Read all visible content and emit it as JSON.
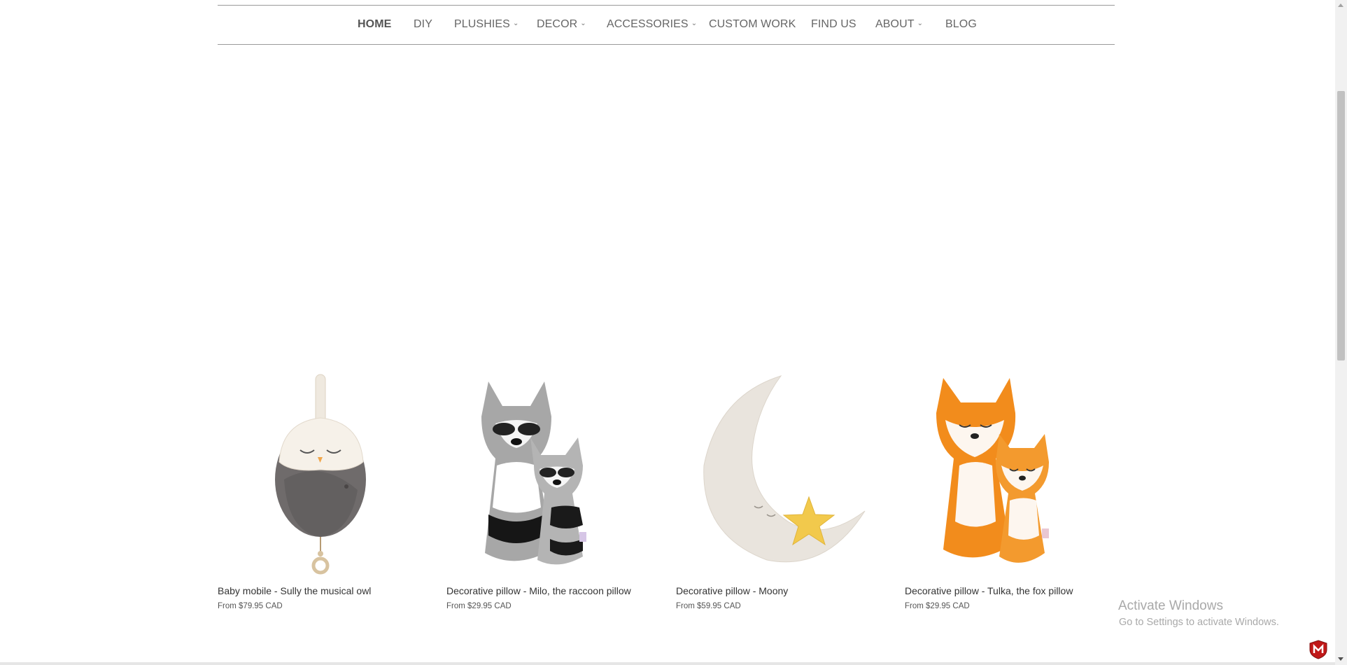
{
  "nav": {
    "items": [
      {
        "label": "HOME",
        "active": true,
        "dropdown": false
      },
      {
        "label": "DIY",
        "dropdown": false
      },
      {
        "label": "PLUSHIES",
        "dropdown": true
      },
      {
        "label": "DECOR",
        "dropdown": true
      },
      {
        "label": "ACCESSORIES",
        "dropdown": true
      },
      {
        "label": "CUSTOM WORK",
        "dropdown": false
      },
      {
        "label": "FIND US",
        "dropdown": false
      },
      {
        "label": "ABOUT",
        "dropdown": true
      },
      {
        "label": "BLOG",
        "dropdown": false
      }
    ],
    "chevron_glyph": "⌄"
  },
  "products": [
    {
      "title": "Baby mobile - Sully the musical owl",
      "price": "From $79.95 CAD",
      "image_icon": "owl-mobile-image"
    },
    {
      "title": "Decorative pillow - Milo, the raccoon pillow",
      "price": "From $29.95 CAD",
      "image_icon": "raccoon-pillow-image"
    },
    {
      "title": "Decorative pillow - Moony",
      "price": "From $59.95 CAD",
      "image_icon": "moon-pillow-image"
    },
    {
      "title": "Decorative pillow - Tulka, the fox pillow",
      "price": "From $29.95 CAD",
      "image_icon": "fox-pillow-image"
    }
  ],
  "watermark": {
    "title": "Activate Windows",
    "subtitle": "Go to Settings to activate Windows."
  },
  "colors": {
    "nav_text": "#666666",
    "nav_border": "#9a9a9a",
    "watermark": "#a9a9a9",
    "fox_orange": "#f28c1c",
    "raccoon_gray": "#9a9a9a",
    "moon_cream": "#e9e4dd",
    "star_yellow": "#f2c94c"
  }
}
